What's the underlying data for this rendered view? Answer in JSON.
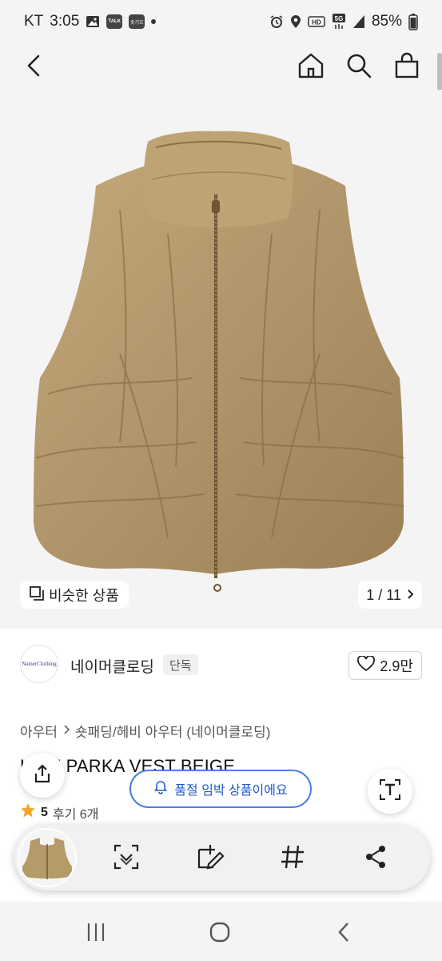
{
  "status_bar": {
    "carrier": "KT",
    "time": "3:05",
    "talk_badge": "TALK",
    "sogi_badge": "숏기오",
    "network": "5G",
    "battery": "85%",
    "icons": [
      "image-icon",
      "talk-icon",
      "notification-icon",
      "dot-icon",
      "alarm-icon",
      "location-icon",
      "hd-icon",
      "5g-icon",
      "signal-icon",
      "battery-icon"
    ]
  },
  "top_nav": {
    "icons": [
      "back-icon",
      "home-icon",
      "search-icon",
      "cart-icon"
    ]
  },
  "hero": {
    "similar_label": "비슷한 상품",
    "pager_text": "1 / 11"
  },
  "brand": {
    "logo_text": "NamerClothing",
    "name": "네이머클로딩",
    "tag": "단독",
    "likes": "2.9만"
  },
  "breadcrumb": {
    "items": [
      "아우터",
      "숏패딩/헤비 아우터 (네이머클로딩)"
    ]
  },
  "product": {
    "title": "L ME PARKA VEST BEIGE",
    "rating": "5",
    "reviews": "후기 6개"
  },
  "toast": {
    "text": "품절 임박 상품이에요"
  },
  "capture_toolbar": {
    "tools": [
      "scan-icon",
      "edit-icon",
      "hashtag-icon",
      "share-icon"
    ]
  },
  "system_nav": {
    "buttons": [
      "recents-icon",
      "home-circle-icon",
      "back-chevron-icon"
    ]
  },
  "colors": {
    "vest": "#b59a6a",
    "toast_border": "#4a7fe0",
    "toast_text": "#1f5bd0",
    "star": "#f5a623"
  }
}
